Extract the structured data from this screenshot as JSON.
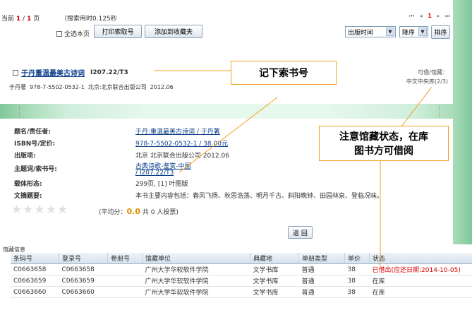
{
  "top": {
    "page_prefix": "当前",
    "page_current": "1",
    "page_slash": "/",
    "page_total": "1",
    "page_suffix": "页",
    "search_time": "（搜索用时0.125秒",
    "pager_glyphs": [
      "⏮",
      "◂",
      "1",
      "▸",
      "⏭"
    ],
    "select_all_label": "全选本页",
    "print_btn": "打印索取号",
    "add_fav_btn": "添加到收藏夹",
    "sort_field": "出版时间",
    "sort_order": "降序",
    "sort_btn": "排序"
  },
  "result": {
    "title": "于丹重温最美古诗词",
    "call_no": "I207.22/T3",
    "author_line": "于丹著  978-7-5502-0532-1  北京:北京联合出版公司  2012.06",
    "avail_label": "可借/馆藏：",
    "avail_value": "中文中央库(2/3)"
  },
  "detail": {
    "rows": [
      {
        "label": "题名/责任者:",
        "value": "于丹:重温最美古诗词 / 于丹著"
      },
      {
        "label": "ISBN号/定价:",
        "value": "978-7-5502-0532-1 / 38.00元"
      },
      {
        "label": "出版项:",
        "value": "北京 北京联合出版公司 2012.06"
      },
      {
        "label": "主题词/索书号:",
        "value": "古典诗歌-鉴赏-中国"
      },
      {
        "label": "",
        "value": "/ I207.22/T3"
      },
      {
        "label": "载体形态:",
        "value": "299页, [1] 叶图版"
      },
      {
        "label": "文摘题要:",
        "value": "本书主要内容包括：春风飞扬、秋思浩荡、明月千古、斜阳晚钟、田园林泉、登临况味。"
      }
    ],
    "rating_prefix": "(平均分：",
    "rating_score": "0.0",
    "rating_suffix": "共 0 人投票)",
    "back_btn": "返 回"
  },
  "holdings": {
    "title": "馆藏信息",
    "headers": [
      "条码号",
      "登录号",
      "卷册号",
      "馆藏单位",
      "典藏地",
      "单册类型",
      "单价",
      "状态"
    ],
    "rows": [
      [
        "C0663658",
        "C0663658",
        "",
        "广州大学华软软件学院",
        "文学书库",
        "普通",
        "38",
        "已借出(应还日期:2014-10-05)"
      ],
      [
        "C0663659",
        "C0663659",
        "",
        "广州大学华软软件学院",
        "文学书库",
        "普通",
        "38",
        "在库"
      ],
      [
        "C0663660",
        "C0663660",
        "",
        "广州大学华软软件学院",
        "文学书库",
        "普通",
        "38",
        "在库"
      ]
    ]
  },
  "annotations": {
    "callout1": "记下索书号",
    "callout2_line1": "注意馆藏状态，在库",
    "callout2_line2": "图书方可借阅",
    "color": "#f3a020"
  }
}
